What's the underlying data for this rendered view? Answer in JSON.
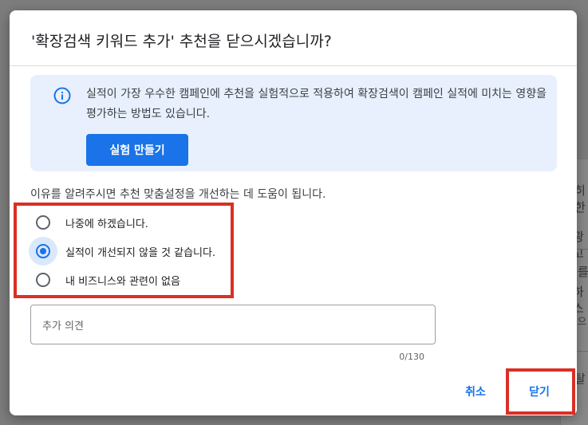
{
  "dialog": {
    "title": "'확장검색 키워드 추가' 추천을 닫으시겠습니까?",
    "info": {
      "icon": "info-icon",
      "text": "실적이 가장 우수한 캠페인에 추천을 실험적으로 적용하여 확장검색이 캠페인 실적에 미치는 영향을 평가하는 방법도 있습니다.",
      "button_label": "실험 만들기"
    },
    "reason_prompt": "이유를 알려주시면 추천 맞춤설정을 개선하는 데 도움이 됩니다.",
    "options": [
      {
        "label": "나중에 하겠습니다.",
        "selected": false
      },
      {
        "label": "실적이 개선되지 않을 것 같습니다.",
        "selected": true
      },
      {
        "label": "내 비즈니스와 관련이 없음",
        "selected": false
      }
    ],
    "comment": {
      "placeholder": "추가 의견",
      "counter": "0/130"
    },
    "footer": {
      "cancel_label": "취소",
      "close_label": "닫기"
    },
    "colors": {
      "accent": "#1a73e8",
      "info_bg": "#e8f0fe",
      "highlight": "#d93025"
    }
  },
  "background": {
    "fragments": [
      "히한",
      "광고",
      "를",
      "하스",
      "으",
      "탈"
    ]
  }
}
